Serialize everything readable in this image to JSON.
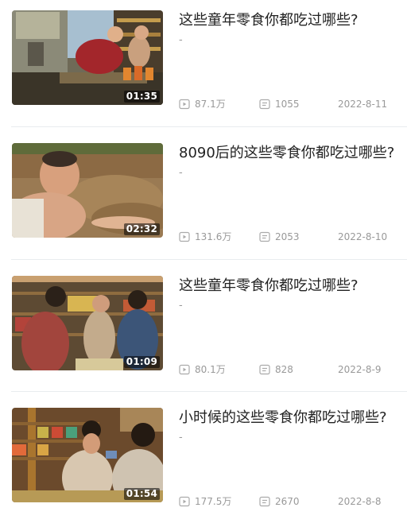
{
  "videos": [
    {
      "title": "这些童年零食你都吃过哪些?",
      "desc": "-",
      "duration": "01:35",
      "views": "87.1万",
      "comments": "1055",
      "date": "2022-8-11"
    },
    {
      "title": "8090后的这些零食你都吃过哪些?",
      "desc": "-",
      "duration": "02:32",
      "views": "131.6万",
      "comments": "2053",
      "date": "2022-8-10"
    },
    {
      "title": "这些童年零食你都吃过哪些?",
      "desc": "-",
      "duration": "01:09",
      "views": "80.1万",
      "comments": "828",
      "date": "2022-8-9"
    },
    {
      "title": "小时候的这些零食你都吃过哪些?",
      "desc": "-",
      "duration": "01:54",
      "views": "177.5万",
      "comments": "2670",
      "date": "2022-8-8"
    }
  ],
  "icons": {
    "views": "play-icon",
    "comments": "comment-icon"
  },
  "colors": {
    "title": "#222222",
    "meta": "#999999",
    "divider": "#e9ecef"
  }
}
